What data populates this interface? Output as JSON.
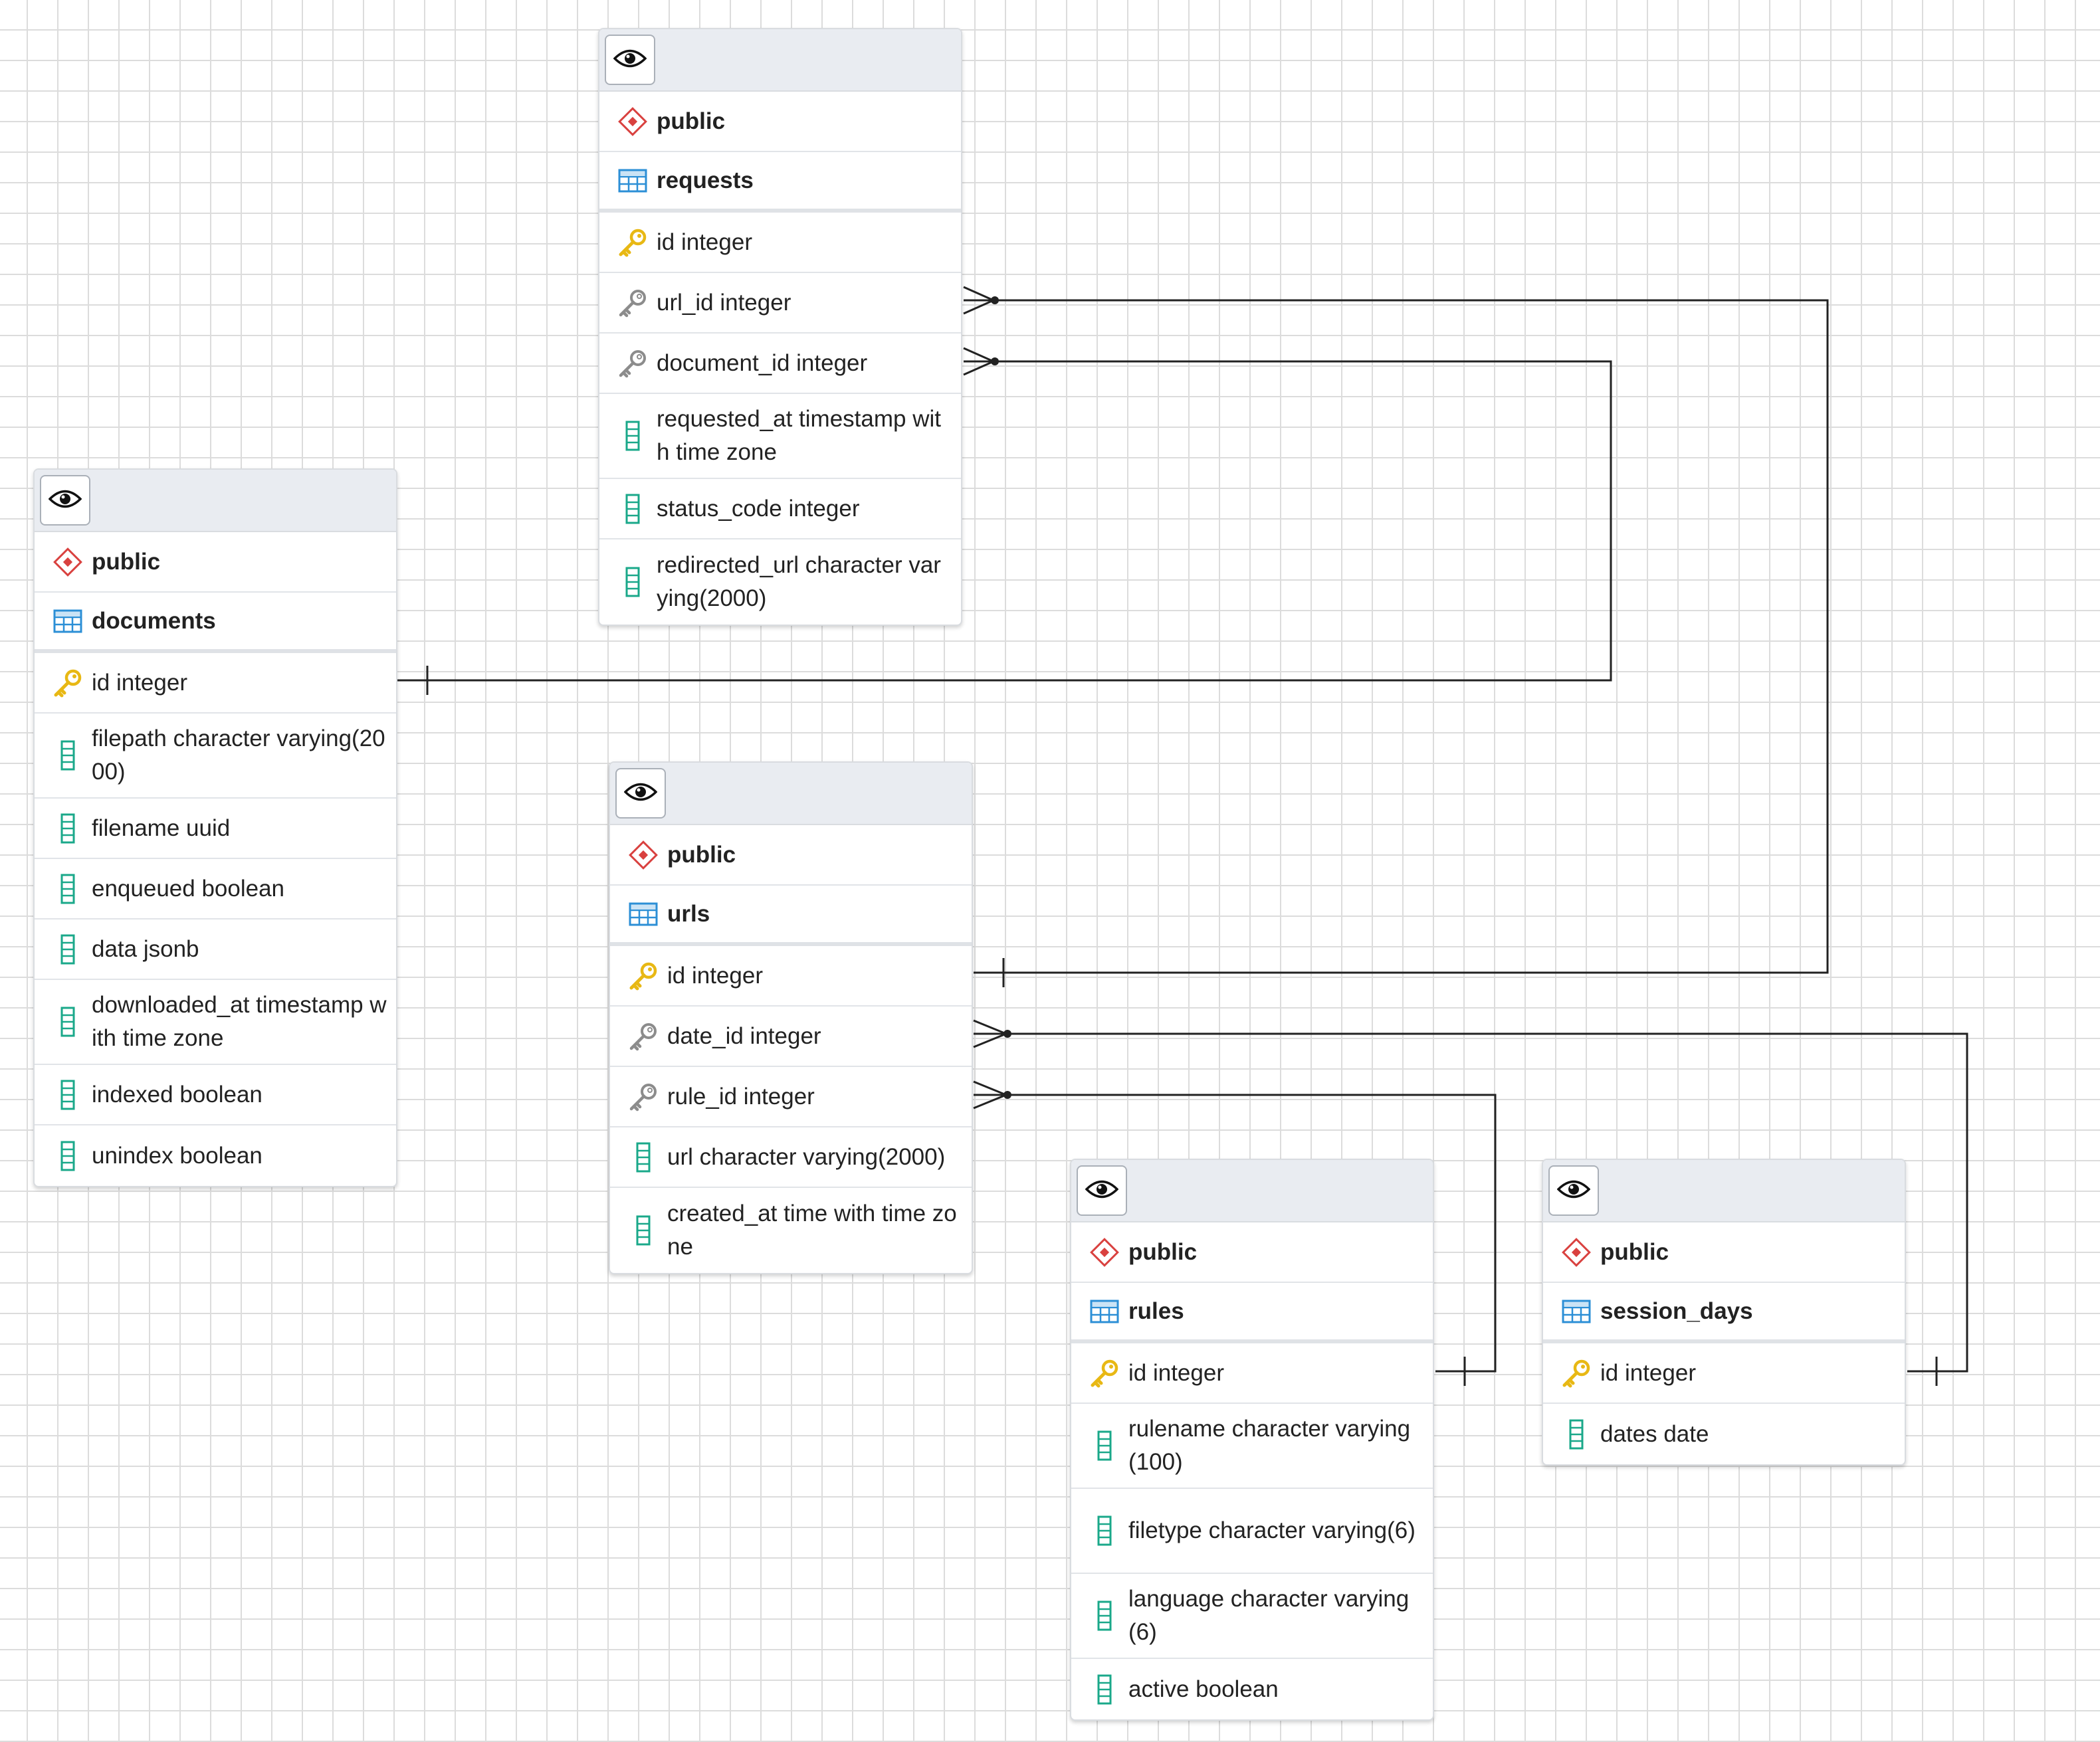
{
  "colors": {
    "schema_icon": "#d9413f",
    "table_icon": "#2c8fd6",
    "pk_icon": "#e8b814",
    "fk_icon": "#8c8c8c",
    "column_icon": "#1aa88a",
    "link_line": "#222222"
  },
  "tables": {
    "requests": {
      "schema": "public",
      "name": "requests",
      "columns": [
        {
          "text": "id integer",
          "icon": "primary-key-icon"
        },
        {
          "text": "url_id integer",
          "icon": "foreign-key-icon"
        },
        {
          "text": "document_id integer",
          "icon": "foreign-key-icon"
        },
        {
          "text": "requested_at timestamp with time zone",
          "icon": "column-icon"
        },
        {
          "text": "status_code integer",
          "icon": "column-icon"
        },
        {
          "text": "redirected_url character varying(2000)",
          "icon": "column-icon"
        }
      ]
    },
    "documents": {
      "schema": "public",
      "name": "documents",
      "columns": [
        {
          "text": "id integer",
          "icon": "primary-key-icon"
        },
        {
          "text": "filepath character varying(2000)",
          "icon": "column-icon"
        },
        {
          "text": "filename uuid",
          "icon": "column-icon"
        },
        {
          "text": "enqueued boolean",
          "icon": "column-icon"
        },
        {
          "text": "data jsonb",
          "icon": "column-icon"
        },
        {
          "text": "downloaded_at timestamp with time zone",
          "icon": "column-icon"
        },
        {
          "text": "indexed boolean",
          "icon": "column-icon"
        },
        {
          "text": "unindex boolean",
          "icon": "column-icon"
        }
      ]
    },
    "urls": {
      "schema": "public",
      "name": "urls",
      "columns": [
        {
          "text": "id integer",
          "icon": "primary-key-icon"
        },
        {
          "text": "date_id integer",
          "icon": "foreign-key-icon"
        },
        {
          "text": "rule_id integer",
          "icon": "foreign-key-icon"
        },
        {
          "text": "url character varying(2000)",
          "icon": "column-icon"
        },
        {
          "text": "created_at time with time zone",
          "icon": "column-icon"
        }
      ]
    },
    "rules": {
      "schema": "public",
      "name": "rules",
      "columns": [
        {
          "text": "id integer",
          "icon": "primary-key-icon"
        },
        {
          "text": "rulename character varying(100)",
          "icon": "column-icon"
        },
        {
          "text": "filetype character varying(6)",
          "icon": "column-icon"
        },
        {
          "text": "language character varying(6)",
          "icon": "column-icon"
        },
        {
          "text": "active boolean",
          "icon": "column-icon"
        }
      ]
    },
    "session_days": {
      "schema": "public",
      "name": "session_days",
      "columns": [
        {
          "text": "id integer",
          "icon": "primary-key-icon"
        },
        {
          "text": "dates date",
          "icon": "column-icon"
        }
      ]
    }
  },
  "relationships": [
    {
      "from": "requests.url_id",
      "to": "urls.id",
      "cardinality": "many-to-one"
    },
    {
      "from": "requests.document_id",
      "to": "documents.id",
      "cardinality": "many-to-one"
    },
    {
      "from": "urls.date_id",
      "to": "session_days.id",
      "cardinality": "many-to-one"
    },
    {
      "from": "urls.rule_id",
      "to": "rules.id",
      "cardinality": "many-to-one"
    }
  ]
}
